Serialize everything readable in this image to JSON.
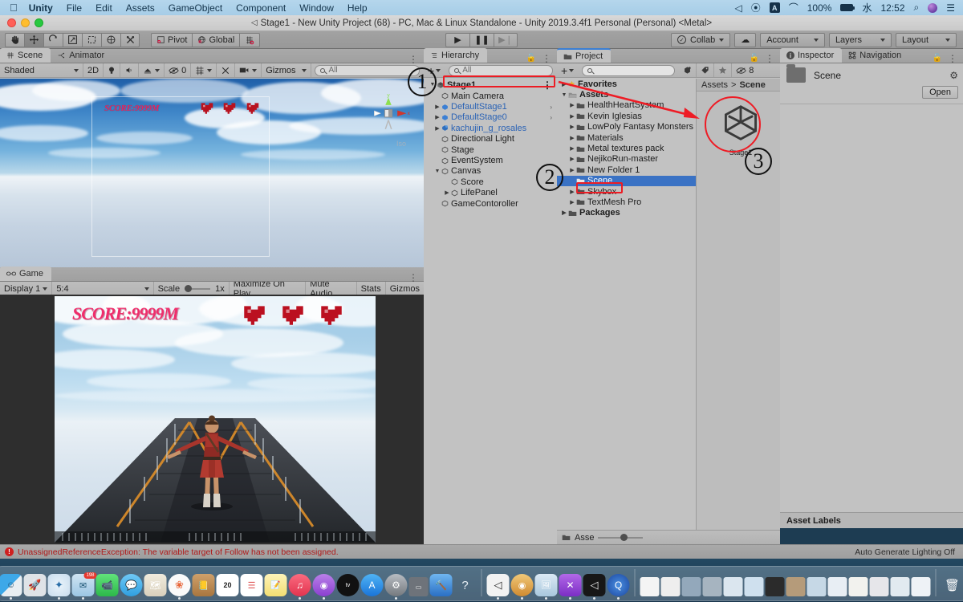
{
  "macmenu": {
    "apple_icon": "apple-icon",
    "items": [
      "Unity",
      "File",
      "Edit",
      "Assets",
      "GameObject",
      "Component",
      "Window",
      "Help"
    ],
    "status": {
      "battery_percent": "100%",
      "input_source": "A",
      "day": "水",
      "time": "12:52",
      "icons": [
        "airplay-icon",
        "podcast-icon",
        "input-source-icon",
        "wifi-icon",
        "battery-icon",
        "clock-icon",
        "spotlight-search-icon",
        "siri-icon",
        "control-center-icon"
      ]
    }
  },
  "window": {
    "title": "Stage1 - New Unity Project (68) - PC, Mac & Linux Standalone - Unity 2019.3.4f1 Personal (Personal) <Metal>",
    "traffic_lights": [
      "close",
      "minimize",
      "zoom"
    ]
  },
  "toolbar": {
    "transform_tools": [
      "hand-tool",
      "move-tool",
      "rotate-tool",
      "scale-tool",
      "rect-tool",
      "transform-tool",
      "custom-editor-tool"
    ],
    "active_tool_index": 1,
    "pivot_label": "Pivot",
    "space_label": "Global",
    "grid_snap_label": "grid-snap-icon",
    "play_label": "play-icon",
    "pause_label": "pause-icon",
    "step_label": "step-icon",
    "collab_label": "Collab",
    "cloud_label": "cloud-icon",
    "account_label": "Account",
    "layers_label": "Layers",
    "layout_label": "Layout"
  },
  "scene_panel": {
    "tabs": [
      {
        "label": "Scene",
        "icon": "scene-grid-icon",
        "active": true
      },
      {
        "label": "Animator",
        "icon": "animator-icon",
        "active": false
      }
    ],
    "toolbar": {
      "shading_mode": "Shaded",
      "dimension_mode": "2D",
      "lighting_icon": "lightbulb-icon",
      "audio_icon": "speaker-icon",
      "fx_icon": "effects-icon",
      "hidden_count": "0",
      "grid_icon": "grid-visibility-icon",
      "tools_icon": "scene-tools-icon",
      "camera_icon": "scene-camera-icon",
      "gizmos_label": "Gizmos",
      "search_placeholder": "All"
    },
    "overlay": {
      "score_text": "SCORE:9999M",
      "hearts": 3
    },
    "gizmo": {
      "axis_y": "y",
      "axis_x": "x",
      "projection": "Iso"
    }
  },
  "game_panel": {
    "tabs": [
      {
        "label": "Game",
        "icon": "game-controller-icon",
        "active": true
      }
    ],
    "toolbar": {
      "display": "Display 1",
      "aspect": "5:4",
      "scale_label": "Scale",
      "scale_value": "1x",
      "maximize_label": "Maximize On Play",
      "mute_label": "Mute Audio",
      "stats_label": "Stats",
      "gizmos_label": "Gizmos"
    },
    "overlay": {
      "score_text": "SCORE:9999M",
      "hearts": 3
    }
  },
  "hierarchy": {
    "tab_label": "Hierarchy",
    "tab_icon": "hierarchy-icon",
    "create_label": "+",
    "search_placeholder": "All",
    "root": {
      "label": "Stage1",
      "icon": "scene-asset-icon",
      "expanded": true,
      "highlighted": true
    },
    "items": [
      {
        "label": "Main Camera",
        "depth": 2,
        "icon": "gameobject-icon",
        "arrow": false,
        "prefab": false
      },
      {
        "label": "DefaultStage1",
        "depth": 2,
        "icon": "prefab-icon",
        "arrow": true,
        "prefab": true,
        "chevron": true
      },
      {
        "label": "DefaultStage0",
        "depth": 2,
        "icon": "prefab-icon",
        "arrow": true,
        "prefab": true,
        "chevron": true
      },
      {
        "label": "kachujin_g_rosales",
        "depth": 2,
        "icon": "model-prefab-icon",
        "arrow": true,
        "prefab": true,
        "chevron": false
      },
      {
        "label": "Directional Light",
        "depth": 2,
        "icon": "gameobject-icon",
        "arrow": false,
        "prefab": false
      },
      {
        "label": "Stage",
        "depth": 2,
        "icon": "gameobject-icon",
        "arrow": false,
        "prefab": false
      },
      {
        "label": "EventSystem",
        "depth": 2,
        "icon": "gameobject-icon",
        "arrow": false,
        "prefab": false
      },
      {
        "label": "Canvas",
        "depth": 2,
        "icon": "gameobject-icon",
        "arrow": true,
        "expanded": true,
        "prefab": false
      },
      {
        "label": "Score",
        "depth": 3,
        "icon": "gameobject-icon",
        "arrow": false,
        "prefab": false
      },
      {
        "label": "LifePanel",
        "depth": 3,
        "icon": "gameobject-icon",
        "arrow": true,
        "prefab": false
      },
      {
        "label": "GameContoroller",
        "depth": 2,
        "icon": "gameobject-icon",
        "arrow": false,
        "prefab": false
      }
    ]
  },
  "project": {
    "tab_label": "Project",
    "tab_icon": "folder-icon",
    "create_label": "+",
    "search_placeholder": "",
    "toolbar_icons": [
      "search-by-type-icon",
      "search-by-label-icon",
      "favorite-star-icon",
      "hidden-packages-icon"
    ],
    "hidden_count": "8",
    "tree": [
      {
        "label": "Favorites",
        "depth": 0,
        "icon": "star-icon",
        "arrow": true,
        "bold": true
      },
      {
        "label": "Assets",
        "depth": 0,
        "icon": "open-folder-icon",
        "arrow": true,
        "expanded": true,
        "bold": true
      },
      {
        "label": "HealthHeartSystem",
        "depth": 1,
        "icon": "folder-icon",
        "arrow": true
      },
      {
        "label": "Kevin Iglesias",
        "depth": 1,
        "icon": "folder-icon",
        "arrow": true
      },
      {
        "label": "LowPoly Fantasy Monsters P",
        "depth": 1,
        "icon": "folder-icon",
        "arrow": true
      },
      {
        "label": "Materials",
        "depth": 1,
        "icon": "folder-icon",
        "arrow": true
      },
      {
        "label": "Metal textures pack",
        "depth": 1,
        "icon": "folder-icon",
        "arrow": true
      },
      {
        "label": "NejikoRun-master",
        "depth": 1,
        "icon": "folder-icon",
        "arrow": true
      },
      {
        "label": "New Folder 1",
        "depth": 1,
        "icon": "folder-icon",
        "arrow": true
      },
      {
        "label": "Scene",
        "depth": 1,
        "icon": "folder-icon",
        "arrow": false,
        "selected": true,
        "highlighted": true
      },
      {
        "label": "Skybox",
        "depth": 1,
        "icon": "folder-icon",
        "arrow": true
      },
      {
        "label": "TextMesh Pro",
        "depth": 1,
        "icon": "folder-icon",
        "arrow": true
      },
      {
        "label": "Packages",
        "depth": 0,
        "icon": "folder-icon",
        "arrow": true,
        "bold": true
      }
    ],
    "breadcrumb": [
      "Assets",
      "Scene"
    ],
    "assets": [
      {
        "label": "Stage1",
        "icon": "unity-scene-icon",
        "circled": true
      }
    ],
    "footer": {
      "label": "Asse",
      "slider_icon": "zoom-slider"
    }
  },
  "inspector": {
    "tabs": [
      {
        "label": "Inspector",
        "icon": "info-icon",
        "active": true
      },
      {
        "label": "Navigation",
        "icon": "navigation-icon",
        "active": false
      }
    ],
    "asset_name": "Scene",
    "asset_icon": "folder-icon",
    "gear_icon": "gear-icon",
    "open_button": "Open",
    "labels_bar": "Asset Labels"
  },
  "statusbar": {
    "error_icon": "error-icon",
    "message": "UnassignedReferenceException: The variable target of Follow has not been assigned.",
    "right_text": "Auto Generate Lighting Off"
  },
  "annotations": [
    {
      "number": "1",
      "target": "hierarchy-stage1-row"
    },
    {
      "number": "2",
      "target": "project-scene-folder"
    },
    {
      "number": "3",
      "target": "project-stage1-asset"
    }
  ],
  "dock": {
    "apps": [
      {
        "name": "finder-icon",
        "glyph": "☺",
        "color": "#2f9fe0",
        "running": true
      },
      {
        "name": "launchpad-icon",
        "glyph": "🚀",
        "color": "#d8dce0",
        "running": false
      },
      {
        "name": "safari-icon",
        "glyph": "🧭",
        "color": "#e8f3fb",
        "running": true
      },
      {
        "name": "mail-icon",
        "glyph": "✉",
        "color": "#a8cde8",
        "running": true,
        "badge": "198"
      },
      {
        "name": "facetime-icon",
        "glyph": "📹",
        "color": "#4cd364",
        "running": false
      },
      {
        "name": "messages-icon",
        "glyph": "💬",
        "color": "#4cb8f0",
        "running": false
      },
      {
        "name": "maps-icon",
        "glyph": "🗺",
        "color": "#e9e2d2",
        "running": false
      },
      {
        "name": "photos-icon",
        "glyph": "❀",
        "color": "#f4f4f4",
        "running": true
      },
      {
        "name": "contacts-icon",
        "glyph": "📒",
        "color": "#c49a63",
        "running": false
      },
      {
        "name": "calendar-icon",
        "glyph": "20",
        "color": "#ffffff",
        "running": false
      },
      {
        "name": "reminders-icon",
        "glyph": "☰",
        "color": "#ffffff",
        "running": false
      },
      {
        "name": "notes-icon",
        "glyph": "📝",
        "color": "#fbe88c",
        "running": false
      },
      {
        "name": "music-icon",
        "glyph": "♫",
        "color": "#f05a6e",
        "running": true
      },
      {
        "name": "podcasts-icon",
        "glyph": "◉",
        "color": "#a05ce0",
        "running": true
      },
      {
        "name": "appletv-icon",
        "glyph": "tv",
        "color": "#1a1a1a",
        "running": false
      },
      {
        "name": "appstore-icon",
        "glyph": "A",
        "color": "#2f8de8",
        "running": false
      },
      {
        "name": "system-preferences-icon",
        "glyph": "⚙",
        "color": "#8f9499",
        "running": true
      },
      {
        "name": "terminal-icon",
        "glyph": "▭",
        "color": "#5c6066",
        "running": false
      },
      {
        "name": "xcode-icon",
        "glyph": "🔨",
        "color": "#2f7fd8",
        "running": false
      },
      {
        "name": "help-icon",
        "glyph": "?",
        "color": "#ffffff",
        "running": false
      }
    ],
    "apps2": [
      {
        "name": "unity-icon",
        "glyph": "◁",
        "color": "#f0f0f0",
        "running": true
      },
      {
        "name": "blender-icon",
        "glyph": "◉",
        "color": "#e8b05a",
        "running": true
      },
      {
        "name": "preview-icon",
        "glyph": "🖼",
        "color": "#cfe0ef",
        "running": true
      },
      {
        "name": "visual-studio-code-icon",
        "glyph": "✕",
        "color": "#8b43c8",
        "running": true
      },
      {
        "name": "unity-hub-icon",
        "glyph": "◁",
        "color": "#1b1b1b",
        "running": true
      },
      {
        "name": "quicktime-icon",
        "glyph": "Q",
        "color": "#2a5fc8",
        "running": true
      }
    ],
    "minimized": [
      {
        "name": "minimized-window-1"
      },
      {
        "name": "minimized-window-2"
      },
      {
        "name": "minimized-window-3"
      },
      {
        "name": "minimized-window-4"
      },
      {
        "name": "minimized-window-5"
      },
      {
        "name": "minimized-window-6"
      },
      {
        "name": "minimized-window-7"
      },
      {
        "name": "minimized-window-8"
      },
      {
        "name": "minimized-window-9"
      },
      {
        "name": "minimized-window-10"
      },
      {
        "name": "minimized-window-11"
      },
      {
        "name": "minimized-window-12"
      },
      {
        "name": "minimized-window-13"
      },
      {
        "name": "minimized-window-14"
      }
    ],
    "trash": {
      "name": "trash-icon",
      "glyph": "🗑"
    }
  },
  "colors": {
    "selection_blue": "#3a72c4",
    "annotation_red": "#ee1c25",
    "error_red": "#b01818",
    "prefab_blue": "#2b63b5",
    "score_pink": "#ef2e6c"
  }
}
